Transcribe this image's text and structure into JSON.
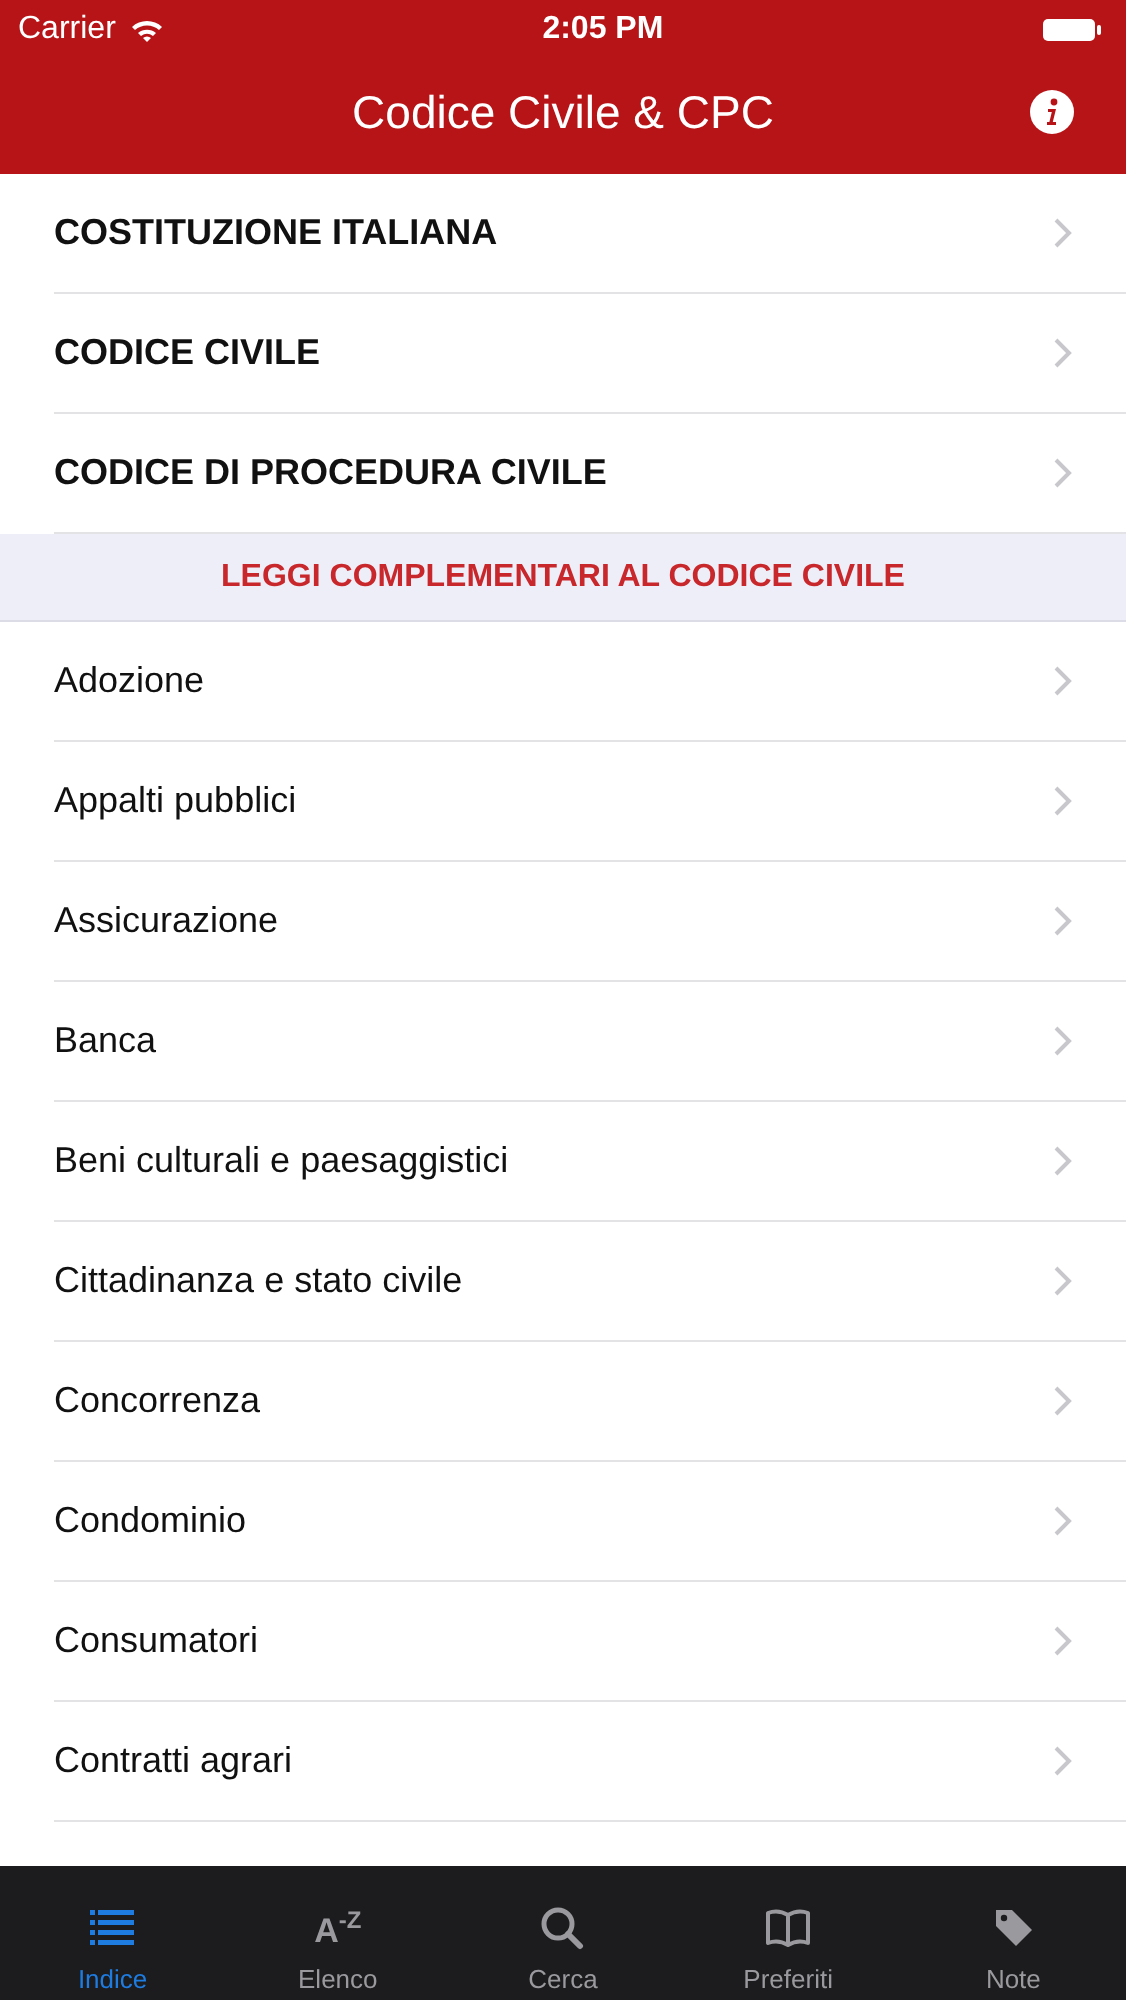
{
  "status_bar": {
    "carrier": "Carrier",
    "time": "2:05 PM"
  },
  "nav_bar": {
    "title": "Codice Civile & CPC"
  },
  "sections": [
    {
      "bold": true,
      "items": [
        "COSTITUZIONE ITALIANA",
        "CODICE CIVILE",
        "CODICE DI PROCEDURA CIVILE"
      ]
    },
    {
      "header": "LEGGI COMPLEMENTARI AL CODICE CIVILE",
      "bold": false,
      "items": [
        "Adozione",
        "Appalti pubblici",
        "Assicurazione",
        "Banca",
        "Beni culturali e paesaggistici",
        "Cittadinanza e stato civile",
        "Concorrenza",
        "Condominio",
        "Consumatori",
        "Contratti agrari"
      ]
    }
  ],
  "tab_bar": [
    {
      "label": "Indice",
      "kind": "list",
      "selected": true
    },
    {
      "label": "Elenco",
      "kind": "az",
      "glyph": "A$^{-Z}$",
      "selected": false
    },
    {
      "label": "Cerca",
      "kind": "search",
      "selected": false
    },
    {
      "label": "Preferiti",
      "kind": "book",
      "selected": false
    },
    {
      "label": "Note",
      "kind": "tag",
      "selected": false
    }
  ]
}
